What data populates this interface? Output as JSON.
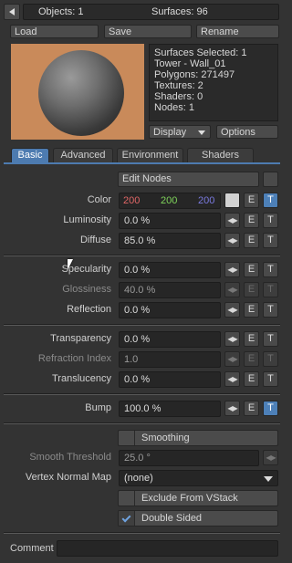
{
  "header": {
    "objects_text": "Objects: 1",
    "surfaces_text": "Surfaces: 96"
  },
  "toolbar": {
    "load": "Load",
    "save": "Save",
    "rename": "Rename"
  },
  "info": {
    "lines": [
      "Surfaces Selected: 1",
      "Tower - Wall_01",
      "Polygons: 271497",
      "Textures: 2",
      "Shaders: 0",
      "Nodes: 1"
    ],
    "display": "Display",
    "options": "Options"
  },
  "tabs": [
    "Basic",
    "Advanced",
    "Environment",
    "Shaders"
  ],
  "edit_nodes": "Edit Nodes",
  "color": {
    "label": "Color",
    "r": "200",
    "g": "200",
    "b": "200",
    "swatch": "#d2d2d2"
  },
  "channels": {
    "luminosity": {
      "label": "Luminosity",
      "value": "0.0 %"
    },
    "diffuse": {
      "label": "Diffuse",
      "value": "85.0 %"
    },
    "specularity": {
      "label": "Specularity",
      "value": "0.0 %"
    },
    "glossiness": {
      "label": "Glossiness",
      "value": "40.0 %"
    },
    "reflection": {
      "label": "Reflection",
      "value": "0.0 %"
    },
    "transparency": {
      "label": "Transparency",
      "value": "0.0 %"
    },
    "refraction": {
      "label": "Refraction Index",
      "value": "1.0"
    },
    "translucency": {
      "label": "Translucency",
      "value": "0.0 %"
    },
    "bump": {
      "label": "Bump",
      "value": "100.0 %"
    }
  },
  "e": "E",
  "t": "T",
  "smoothing": {
    "button": "Smoothing",
    "threshold_label": "Smooth Threshold",
    "threshold_value": "25.0 °",
    "vnmap_label": "Vertex Normal Map",
    "vnmap_value": "(none)",
    "exclude": "Exclude From VStack",
    "double_sided": "Double Sided"
  },
  "comment": {
    "label": "Comment",
    "value": ""
  },
  "colors": {
    "accent": "#4d7bb0",
    "red_value": "#e06666",
    "green_value": "#7fd35a",
    "blue_value": "#7a7ae0",
    "preview_bg": "#c98a5a"
  }
}
